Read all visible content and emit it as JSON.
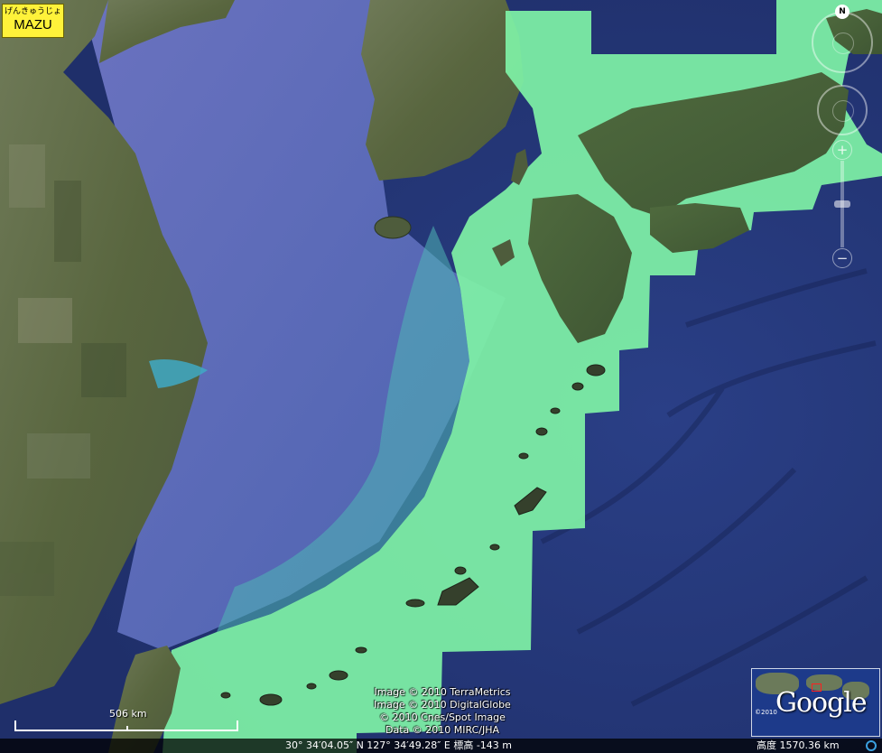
{
  "badge": {
    "ruby": "げんきゅうじょ",
    "word": "MAZU"
  },
  "compass": {
    "north_label": "N"
  },
  "zoom": {
    "plus_label": "+",
    "minus_label": "−"
  },
  "attribution": [
    "Image © 2010 TerraMetrics",
    "Image © 2010 DigitalGlobe",
    "© 2010 Cnes/Spot Image",
    "Data © 2010 MIRC/JHA"
  ],
  "scale": {
    "label": "506 km"
  },
  "status": {
    "coordinates": "30° 34′04.05″ N   127° 34′49.28″ E  標高 -143 m",
    "altitude": "高度  1570.36 km"
  },
  "overview": {
    "logo": "Google",
    "copyright": "©2010"
  },
  "colors": {
    "ocean_deep": "#24397a",
    "sea_shallow": "#5a6fb4",
    "highlight": "#7ff2a6",
    "land": "#5e6b4a",
    "badge": "#fff23a"
  }
}
